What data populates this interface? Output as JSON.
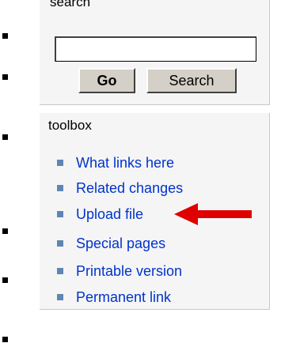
{
  "search": {
    "title": "search",
    "input_value": "",
    "go_label": "Go",
    "search_label": "Search"
  },
  "toolbox": {
    "title": "toolbox",
    "items": [
      {
        "label": "What links here"
      },
      {
        "label": "Related changes"
      },
      {
        "label": "Upload file"
      },
      {
        "label": "Special pages"
      },
      {
        "label": "Printable version"
      },
      {
        "label": "Permanent link"
      }
    ]
  },
  "annotation": {
    "arrow_color": "#e00000",
    "points_to": "Upload file"
  },
  "colors": {
    "link": "#0033cc",
    "bullet": "#5f86b3",
    "portlet_bg": "#f5f5f5",
    "button_face": "#d4d0c8"
  }
}
